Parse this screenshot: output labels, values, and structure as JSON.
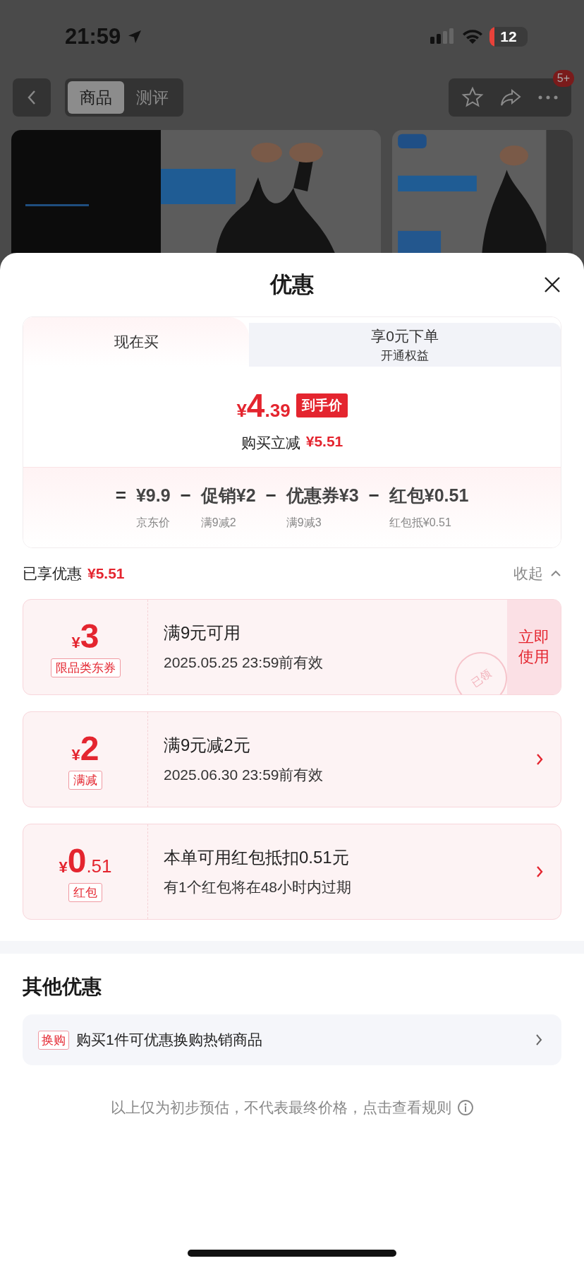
{
  "status_bar": {
    "time": "21:59",
    "battery": "12"
  },
  "nav": {
    "tabs": [
      {
        "label": "商品",
        "selected": true
      },
      {
        "label": "测评",
        "selected": false
      }
    ],
    "more_badge": "5+"
  },
  "sheet": {
    "title": "优惠",
    "mode_tabs": [
      {
        "label": "现在买",
        "selected": true
      },
      {
        "label": "享0元下单",
        "sublabel": "开通权益",
        "selected": false
      }
    ],
    "price": {
      "currency": "¥",
      "integer": "4",
      "decimals": ".39",
      "badge": "到手价",
      "saving_label": "购买立减",
      "saving": "¥5.51"
    },
    "breakdown": [
      {
        "op": "=",
        "amount": "¥9.9",
        "note": "京东价"
      },
      {
        "op": "−",
        "amount": "促销¥2",
        "note": "满9减2"
      },
      {
        "op": "−",
        "amount": "优惠券¥3",
        "note": "满9减3"
      },
      {
        "op": "−",
        "amount": "红包¥0.51",
        "note": "红包抵¥0.51"
      }
    ],
    "enjoyed": {
      "label": "已享优惠",
      "amount": "¥5.51",
      "toggle": "收起",
      "expanded": true
    },
    "coupons": [
      {
        "currency": "¥",
        "integer": "3",
        "tag": "限品类东券",
        "title": "满9元可用",
        "detail": "2025.05.25 23:59前有效",
        "stamp": "已领",
        "action": {
          "kind": "button",
          "label": "立即使用"
        }
      },
      {
        "currency": "¥",
        "integer": "2",
        "tag": "满减",
        "title": "满9元减2元",
        "detail": "2025.06.30 23:59前有效",
        "action": {
          "kind": "chevron"
        }
      },
      {
        "currency": "¥",
        "integer": "0",
        "decimals": ".51",
        "tag": "红包",
        "title": "本单可用红包抵扣0.51元",
        "detail": "有1个红包将在48小时内过期",
        "action": {
          "kind": "chevron"
        }
      }
    ],
    "other": {
      "title": "其他优惠",
      "items": [
        {
          "tag": "换购",
          "text": "购买1件可优惠换购热销商品"
        }
      ]
    },
    "footnote": "以上仅为初步预估，不代表最终价格，点击查看规则"
  }
}
